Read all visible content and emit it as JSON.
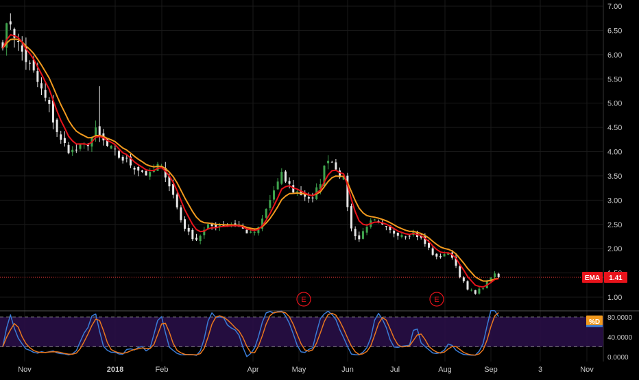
{
  "colors": {
    "background": "#000000",
    "grid": "#1a1a1a",
    "axis_text": "#c8c8c8",
    "candle_up": "#3fa34d",
    "candle_down": "#e6e6e6",
    "ema_fast": "#e8131b",
    "ema_slow": "#f29a1e",
    "price_line": "#ff3b3b",
    "ema_badge": "#e8131b",
    "stoch_band": "#2a0f4a",
    "stoch_k": "#3a7bd5",
    "stoch_d": "#e8771e",
    "stoch_dash": "#777777",
    "pd_badge": "#f29a1e",
    "event_marker": "#e8131b"
  },
  "price_axis": {
    "ticks": [
      "7.00",
      "6.50",
      "6.00",
      "5.50",
      "5.00",
      "4.50",
      "4.00",
      "3.50",
      "3.00",
      "2.50",
      "2.00",
      "1.50",
      "1.00"
    ]
  },
  "ema_badge": {
    "label": "EMA",
    "value": "1.41"
  },
  "stoch_axis": {
    "ticks": [
      "80.0000",
      "40.0000",
      "0.0000"
    ]
  },
  "stoch_badge": {
    "label": "%D"
  },
  "time_axis": {
    "labels": [
      "Nov",
      "2018",
      "Feb",
      "Apr",
      "May",
      "Jun",
      "Jul",
      "Aug",
      "Sep",
      "3",
      "Nov"
    ]
  },
  "events": [
    {
      "label": "E",
      "date": "May"
    },
    {
      "label": "E",
      "date": "Aug"
    }
  ],
  "chart_data": {
    "type": "candlestick",
    "y_range": [
      0.7,
      7.0
    ],
    "log_scale": false,
    "grid": true,
    "current_price": 1.41,
    "price_anchors": [
      [
        0,
        6.3
      ],
      [
        2,
        6.7
      ],
      [
        4,
        6.2
      ],
      [
        8,
        5.6
      ],
      [
        12,
        4.9
      ],
      [
        15,
        4.2
      ],
      [
        18,
        4.0
      ],
      [
        21,
        4.1
      ],
      [
        24,
        4.4
      ],
      [
        27,
        4.1
      ],
      [
        30,
        3.9
      ],
      [
        34,
        3.7
      ],
      [
        38,
        3.5
      ],
      [
        40,
        3.7
      ],
      [
        42,
        3.55
      ],
      [
        44,
        3.1
      ],
      [
        46,
        2.6
      ],
      [
        48,
        2.3
      ],
      [
        50,
        2.2
      ],
      [
        53,
        2.45
      ],
      [
        56,
        2.5
      ],
      [
        60,
        2.5
      ],
      [
        64,
        2.3
      ],
      [
        66,
        2.4
      ],
      [
        68,
        2.8
      ],
      [
        70,
        3.2
      ],
      [
        72,
        3.5
      ],
      [
        75,
        3.2
      ],
      [
        78,
        3.1
      ],
      [
        80,
        3.0
      ],
      [
        82,
        3.4
      ],
      [
        84,
        3.9
      ],
      [
        86,
        3.7
      ],
      [
        88,
        3.4
      ],
      [
        90,
        2.4
      ],
      [
        92,
        2.2
      ],
      [
        94,
        2.5
      ],
      [
        96,
        2.55
      ],
      [
        100,
        2.35
      ],
      [
        104,
        2.3
      ],
      [
        106,
        2.35
      ],
      [
        108,
        2.2
      ],
      [
        110,
        2.0
      ],
      [
        112,
        1.8
      ],
      [
        114,
        1.9
      ],
      [
        116,
        1.85
      ],
      [
        118,
        1.45
      ],
      [
        120,
        1.15
      ],
      [
        122,
        1.1
      ],
      [
        124,
        1.2
      ],
      [
        126,
        1.4
      ],
      [
        128,
        1.55
      ]
    ],
    "spikes": [
      [
        25,
        5.35,
        4.2
      ]
    ],
    "stoch_range": [
      0,
      100
    ],
    "stoch_levels": [
      80,
      20
    ],
    "stoch_d_last": 72
  }
}
